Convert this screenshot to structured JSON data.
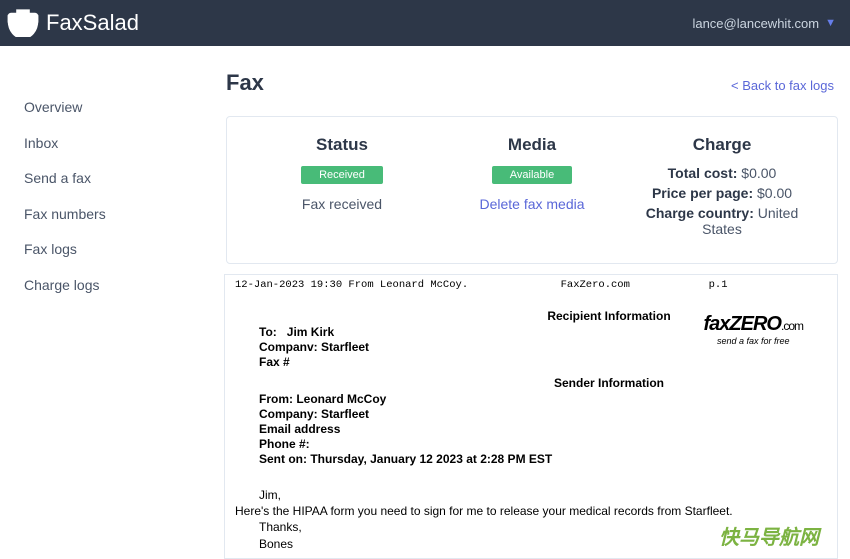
{
  "header": {
    "brand": "FaxSalad",
    "user_email": "lance@lancewhit.com"
  },
  "sidebar": {
    "items": [
      {
        "label": "Overview"
      },
      {
        "label": "Inbox"
      },
      {
        "label": "Send a fax"
      },
      {
        "label": "Fax numbers"
      },
      {
        "label": "Fax logs"
      },
      {
        "label": "Charge logs"
      }
    ]
  },
  "page": {
    "title": "Fax",
    "back_link": "< Back to fax logs"
  },
  "status": {
    "heading": "Status",
    "badge": "Received",
    "text": "Fax received"
  },
  "media": {
    "heading": "Media",
    "badge": "Available",
    "link": "Delete fax media"
  },
  "charge": {
    "heading": "Charge",
    "total_label": "Total cost:",
    "total_value": "$0.00",
    "ppp_label": "Price per page:",
    "ppp_value": "$0.00",
    "country_label": "Charge country:",
    "country_value": "United States"
  },
  "fax": {
    "top_left": "12-Jan-2023  19:30   From Leonard McCoy.",
    "top_mid": "FaxZero.com",
    "top_right": "p.1",
    "recipient_title": "Recipient Information",
    "to_label": "To:",
    "to_value": "Jim Kirk",
    "company_r_label": "Companv:",
    "company_r_value": "Starfleet",
    "faxnum_label": "Fax #",
    "sender_title": "Sender Information",
    "from_label": "From:",
    "from_value": "Leonard McCoy",
    "company_s_label": "Company:",
    "company_s_value": "Starfleet",
    "email_label": "Email address",
    "phone_label": "Phone #:",
    "sent_label": "Sent on:",
    "sent_value": "Thursday, January 12 2023 at 2:28 PM EST",
    "faxzero_brand": "faxZERO",
    "faxzero_com": ".com",
    "faxzero_tag": "send a fax for free",
    "msg_greet": "Jim,",
    "msg_body": "Here's the HIPAA form you need to sign for me to release your medical records from Starfleet.",
    "msg_thanks": "Thanks,",
    "msg_sign": "Bones"
  },
  "watermark": "快马导航网"
}
